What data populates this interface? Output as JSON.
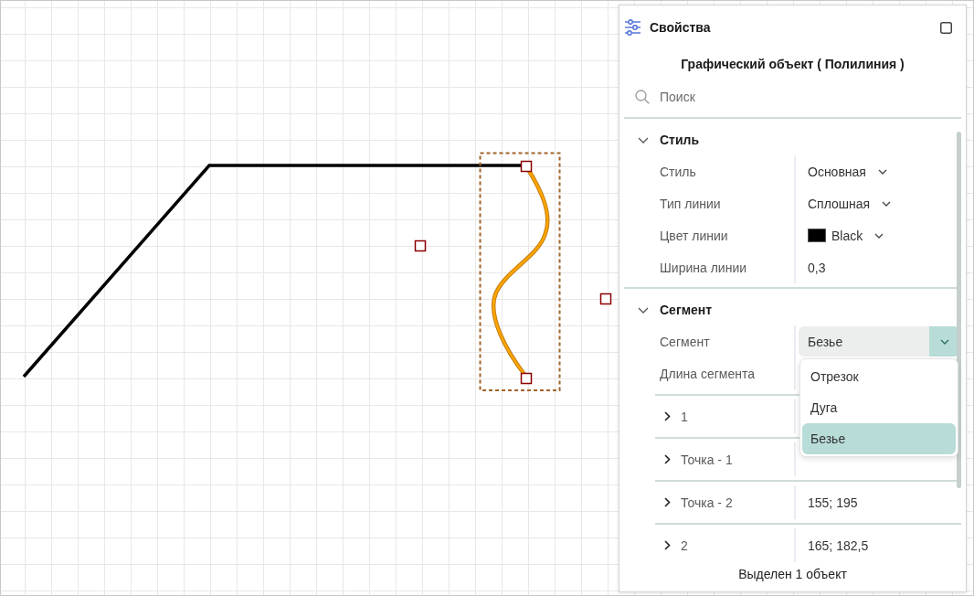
{
  "properties_panel": {
    "title": "Свойства",
    "object_title": "Графический объект ( Полилиния )",
    "search": {
      "placeholder": "Поиск"
    },
    "sections": [
      {
        "title": "Стиль",
        "expanded": true,
        "rows": [
          {
            "kind": "dropdown",
            "label": "Стиль",
            "value": "Основная"
          },
          {
            "kind": "dropdown",
            "label": "Тип линии",
            "value": "Сплошная"
          },
          {
            "kind": "color",
            "label": "Цвет линии",
            "value": "Black",
            "color": "#000000"
          },
          {
            "kind": "text",
            "label": "Ширина линии",
            "value": "0,3"
          }
        ]
      },
      {
        "title": "Сегмент",
        "expanded": true,
        "rows": [
          {
            "kind": "select",
            "label": "Сегмент",
            "value": "Безье",
            "open": true,
            "options": [
              {
                "label": "Отрезок",
                "selected": false
              },
              {
                "label": "Дуга",
                "selected": false
              },
              {
                "label": "Безье",
                "selected": true
              }
            ]
          },
          {
            "kind": "text",
            "label": "Длина сегмента"
          },
          {
            "kind": "group",
            "label": "1",
            "expanded": false
          },
          {
            "kind": "group",
            "label": "Точка - 1",
            "expanded": false
          },
          {
            "kind": "group",
            "label": "Точка - 2",
            "expanded": false,
            "value": "155; 195"
          },
          {
            "kind": "group",
            "label": "2",
            "expanded": false,
            "value": "165; 182,5"
          }
        ]
      }
    ],
    "status": "Выделен 1 объект"
  }
}
